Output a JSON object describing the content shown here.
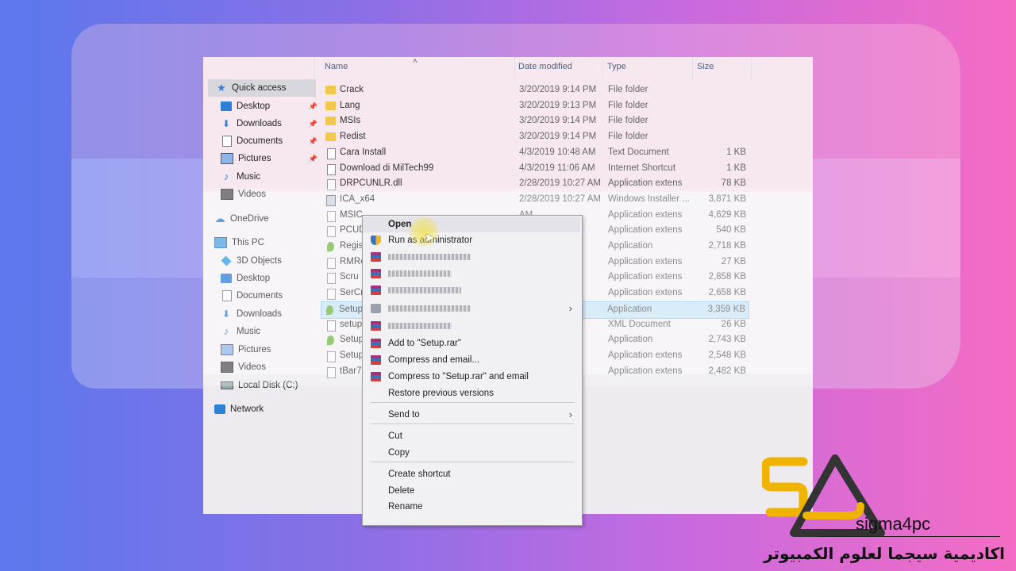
{
  "columns": {
    "name": "Name",
    "date": "Date modified",
    "type": "Type",
    "size": "Size"
  },
  "nav": [
    {
      "label": "Quick access",
      "icon": "star-icon",
      "pinned": false
    },
    {
      "label": "Desktop",
      "icon": "desktop-icon",
      "pinned": true
    },
    {
      "label": "Downloads",
      "icon": "download-icon",
      "pinned": true
    },
    {
      "label": "Documents",
      "icon": "documents-icon",
      "pinned": true
    },
    {
      "label": "Pictures",
      "icon": "pictures-icon",
      "pinned": true
    },
    {
      "label": "Music",
      "icon": "music-icon",
      "pinned": false
    },
    {
      "label": "Videos",
      "icon": "videos-icon",
      "pinned": false
    },
    {
      "label": "OneDrive",
      "icon": "onedrive-icon",
      "pinned": false
    },
    {
      "label": "This PC",
      "icon": "pc-icon",
      "pinned": false
    },
    {
      "label": "3D Objects",
      "icon": "3d-objects-icon",
      "pinned": false
    },
    {
      "label": "Desktop",
      "icon": "desktop-icon",
      "pinned": false
    },
    {
      "label": "Documents",
      "icon": "documents-icon",
      "pinned": false
    },
    {
      "label": "Downloads",
      "icon": "download-icon",
      "pinned": false
    },
    {
      "label": "Music",
      "icon": "music-icon",
      "pinned": false
    },
    {
      "label": "Pictures",
      "icon": "pictures-icon",
      "pinned": false
    },
    {
      "label": "Videos",
      "icon": "videos-icon",
      "pinned": false
    },
    {
      "label": "Local Disk (C:)",
      "icon": "disk-icon",
      "pinned": false
    },
    {
      "label": "Network",
      "icon": "network-icon",
      "pinned": false
    }
  ],
  "files": [
    {
      "name": "Crack",
      "date": "3/20/2019 9:14 PM",
      "type": "File folder",
      "size": "",
      "icon": "folder-icon"
    },
    {
      "name": "Lang",
      "date": "3/20/2019 9:13 PM",
      "type": "File folder",
      "size": "",
      "icon": "folder-icon"
    },
    {
      "name": "MSIs",
      "date": "3/20/2019 9:14 PM",
      "type": "File folder",
      "size": "",
      "icon": "folder-icon"
    },
    {
      "name": "Redist",
      "date": "3/20/2019 9:14 PM",
      "type": "File folder",
      "size": "",
      "icon": "folder-icon"
    },
    {
      "name": "Cara Install",
      "date": "4/3/2019 10:48 AM",
      "type": "Text Document",
      "size": "1 KB",
      "icon": "text-file-icon"
    },
    {
      "name": "Download di MilTech99",
      "date": "4/3/2019 11:06 AM",
      "type": "Internet Shortcut",
      "size": "1 KB",
      "icon": "shortcut-icon"
    },
    {
      "name": "DRPCUNLR.dll",
      "date": "2/28/2019 10:27 AM",
      "type": "Application extens",
      "size": "78 KB",
      "icon": "dll-icon"
    },
    {
      "name": "ICA_x64",
      "date": "2/28/2019 10:27 AM",
      "type": "Windows Installer ...",
      "size": "3,871 KB",
      "icon": "msi-icon"
    },
    {
      "name": "MSIC",
      "date": "AM",
      "type": "Application extens",
      "size": "4,629 KB",
      "icon": "dll-icon"
    },
    {
      "name": "PCUD",
      "date": "AM",
      "type": "Application extens",
      "size": "540 KB",
      "icon": "dll-icon"
    },
    {
      "name": "Regis",
      "date": "AM",
      "type": "Application",
      "size": "2,718 KB",
      "icon": "app-icon"
    },
    {
      "name": "RMRe",
      "date": "AM",
      "type": "Application extens",
      "size": "27 KB",
      "icon": "dll-icon"
    },
    {
      "name": "Scru",
      "date": "AM",
      "type": "Application extens",
      "size": "2,858 KB",
      "icon": "dll-icon"
    },
    {
      "name": "SerCr",
      "date": "AM",
      "type": "Application extens",
      "size": "2,658 KB",
      "icon": "dll-icon"
    },
    {
      "name": "Setup",
      "date": "M",
      "type": "Application",
      "size": "3,359 KB",
      "icon": "app-icon",
      "selected": true
    },
    {
      "name": "setup",
      "date": "AM",
      "type": "XML Document",
      "size": "26 KB",
      "icon": "xml-icon"
    },
    {
      "name": "Setup",
      "date": "AM",
      "type": "Application",
      "size": "2,743 KB",
      "icon": "app-icon"
    },
    {
      "name": "Setup",
      "date": "AM",
      "type": "Application extens",
      "size": "2,548 KB",
      "icon": "dll-icon"
    },
    {
      "name": "tBar7.",
      "date": "AM",
      "type": "Application extens",
      "size": "2,482 KB",
      "icon": "dll-icon"
    }
  ],
  "context_menu": [
    {
      "label": "Open",
      "bold": true,
      "icon": "",
      "submenu": false
    },
    {
      "label": "Run as administrator",
      "icon": "shield-icon",
      "submenu": false
    },
    {
      "label": "",
      "icon": "winrar-icon",
      "submenu": false
    },
    {
      "label": "",
      "icon": "winrar-icon",
      "submenu": false
    },
    {
      "label": "",
      "icon": "winrar-icon",
      "submenu": false
    },
    {
      "label": "",
      "icon": "generic-icon",
      "submenu": true
    },
    {
      "label": "",
      "icon": "winrar-icon",
      "submenu": false
    },
    {
      "label": "Add to \"Setup.rar\"",
      "icon": "winrar-icon",
      "submenu": false
    },
    {
      "label": "Compress and email...",
      "icon": "winrar-icon",
      "submenu": false
    },
    {
      "label": "Compress to \"Setup.rar\" and email",
      "icon": "winrar-icon",
      "submenu": false
    },
    {
      "label": "Restore previous versions",
      "icon": "",
      "submenu": false
    },
    {
      "label": "Send to",
      "icon": "",
      "submenu": true
    },
    {
      "label": "Cut",
      "icon": "",
      "submenu": false
    },
    {
      "label": "Copy",
      "icon": "",
      "submenu": false
    },
    {
      "label": "Create shortcut",
      "icon": "",
      "submenu": false
    },
    {
      "label": "Delete",
      "icon": "",
      "submenu": false
    },
    {
      "label": "Rename",
      "icon": "",
      "submenu": false
    }
  ],
  "logo": {
    "brand": "sigma4pc",
    "tagline": "اكاديمية سيجما لعلوم الكمبيوتر"
  }
}
